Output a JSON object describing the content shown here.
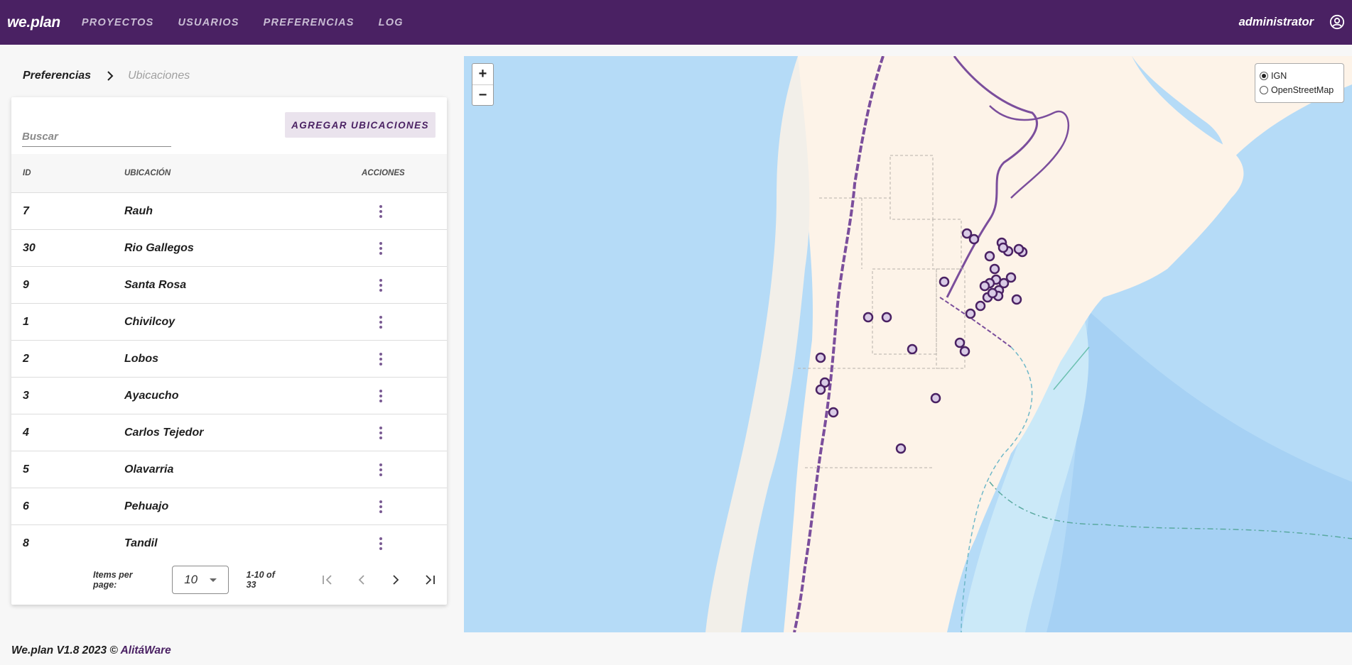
{
  "app": {
    "brand": "we.plan",
    "nav": [
      "PROYECTOS",
      "USUARIOS",
      "PREFERENCIAS",
      "LOG"
    ],
    "user": "administrator"
  },
  "breadcrumb": {
    "home": "Preferencias",
    "current": "Ubicaciones"
  },
  "toolbar": {
    "search_placeholder": "Buscar",
    "add_label": "AGREGAR UBICACIONES"
  },
  "table": {
    "headers": {
      "id": "ID",
      "location": "UBICACIÓN",
      "actions": "ACCIONES"
    },
    "rows": [
      {
        "id": "7",
        "location": "Rauh"
      },
      {
        "id": "30",
        "location": "Rio Gallegos"
      },
      {
        "id": "9",
        "location": "Santa Rosa"
      },
      {
        "id": "1",
        "location": "Chivilcoy"
      },
      {
        "id": "2",
        "location": "Lobos"
      },
      {
        "id": "3",
        "location": "Ayacucho"
      },
      {
        "id": "4",
        "location": "Carlos Tejedor"
      },
      {
        "id": "5",
        "location": "Olavarria"
      },
      {
        "id": "6",
        "location": "Pehuajo"
      },
      {
        "id": "8",
        "location": "Tandil"
      }
    ]
  },
  "paginator": {
    "label": "Items per page:",
    "page_size": "10",
    "range": "1-10 of 33"
  },
  "map": {
    "zoom_in": "+",
    "zoom_out": "−",
    "layers": [
      {
        "label": "IGN",
        "selected": true
      },
      {
        "label": "OpenStreetMap",
        "selected": false
      }
    ],
    "marker_count": 33
  },
  "footer": {
    "text": "We.plan V1.8 2023 © ",
    "link": "AlitáWare"
  },
  "colors": {
    "primary": "#4a2163",
    "water": "#b5dbf7",
    "land": "#fdf3e8",
    "marker": "#4a2163"
  }
}
